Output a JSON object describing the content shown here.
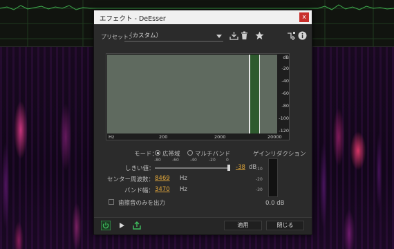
{
  "dialog": {
    "title": "エフェクト - DeEsser",
    "close_label": "x"
  },
  "preset": {
    "label": "プリセット：",
    "value": "（カスタム）"
  },
  "toolbar_icons": [
    "save-preset-icon",
    "delete-preset-icon",
    "favorite-star-icon",
    "routing-icon",
    "info-icon"
  ],
  "graph": {
    "x_ticks": [
      "Hz",
      "200",
      "2000",
      "20000"
    ],
    "y_ticks": [
      "dB",
      "-20",
      "-40",
      "-60",
      "-80",
      "-100",
      "-120"
    ],
    "band_color": "#2e5a2e",
    "plot_color": "#5f6a5f"
  },
  "mode": {
    "label": "モード：",
    "options": [
      "広帯域",
      "マルチバンド"
    ],
    "selected": "広帯域"
  },
  "threshold": {
    "label": "しきい値：",
    "scale": [
      "-80",
      "-60",
      "-40",
      "-20",
      "0"
    ],
    "value": "-38",
    "unit": "dB"
  },
  "center_freq": {
    "label": "センター周波数：",
    "value": "8469",
    "unit": "Hz"
  },
  "bandwidth": {
    "label": "バンド幅：",
    "value": "3470",
    "unit": "Hz"
  },
  "gain_reduction": {
    "label": "ゲインリダクション",
    "ticks": [
      "-10",
      "-20",
      "-30"
    ],
    "value": "0.0 dB"
  },
  "sibilance_only": {
    "label": "歯擦音のみを出力",
    "checked": false
  },
  "footer": {
    "apply_label": "適用",
    "close_label": "閉じる"
  },
  "colors": {
    "accent_value": "#e0a63a",
    "power_green": "#3fbf5f",
    "close_red": "#c9302c"
  }
}
